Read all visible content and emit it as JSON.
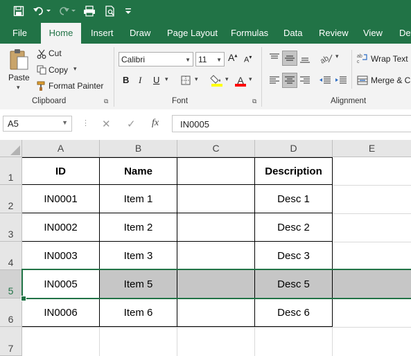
{
  "ribbon_tabs": [
    "File",
    "Home",
    "Insert",
    "Draw",
    "Page Layout",
    "Formulas",
    "Data",
    "Review",
    "View",
    "Dev"
  ],
  "clipboard": {
    "paste": "Paste",
    "cut": "Cut",
    "copy": "Copy",
    "format_painter": "Format Painter",
    "group": "Clipboard"
  },
  "font": {
    "name": "Calibri",
    "size": "11",
    "group": "Font",
    "bold": "B",
    "italic": "I",
    "underline": "U",
    "color_a": "A"
  },
  "alignment": {
    "wrap_text": "Wrap Text",
    "merge": "Merge & C",
    "group": "Alignment"
  },
  "name_box": "A5",
  "formula_bar": {
    "fx": "fx",
    "value": "IN0005"
  },
  "columns": [
    "A",
    "B",
    "C",
    "D",
    "E"
  ],
  "rows": [
    "1",
    "2",
    "3",
    "4",
    "5",
    "6",
    "7"
  ],
  "table": {
    "headers": [
      "ID",
      "Name",
      "",
      "Description"
    ],
    "rows": [
      [
        "IN0001",
        "Item 1",
        "",
        "Desc 1"
      ],
      [
        "IN0002",
        "Item 2",
        "",
        "Desc 2"
      ],
      [
        "IN0003",
        "Item 3",
        "",
        "Desc 3"
      ],
      [
        "IN0005",
        "Item 5",
        "",
        "Desc 5"
      ],
      [
        "IN0006",
        "Item 6",
        "",
        "Desc 6"
      ]
    ]
  },
  "colors": {
    "accent": "#217346",
    "selection": "#c6c6c6",
    "header_bg": "#e6e6e6",
    "font_color": "#ff0000",
    "highlight": "#ffff00"
  }
}
